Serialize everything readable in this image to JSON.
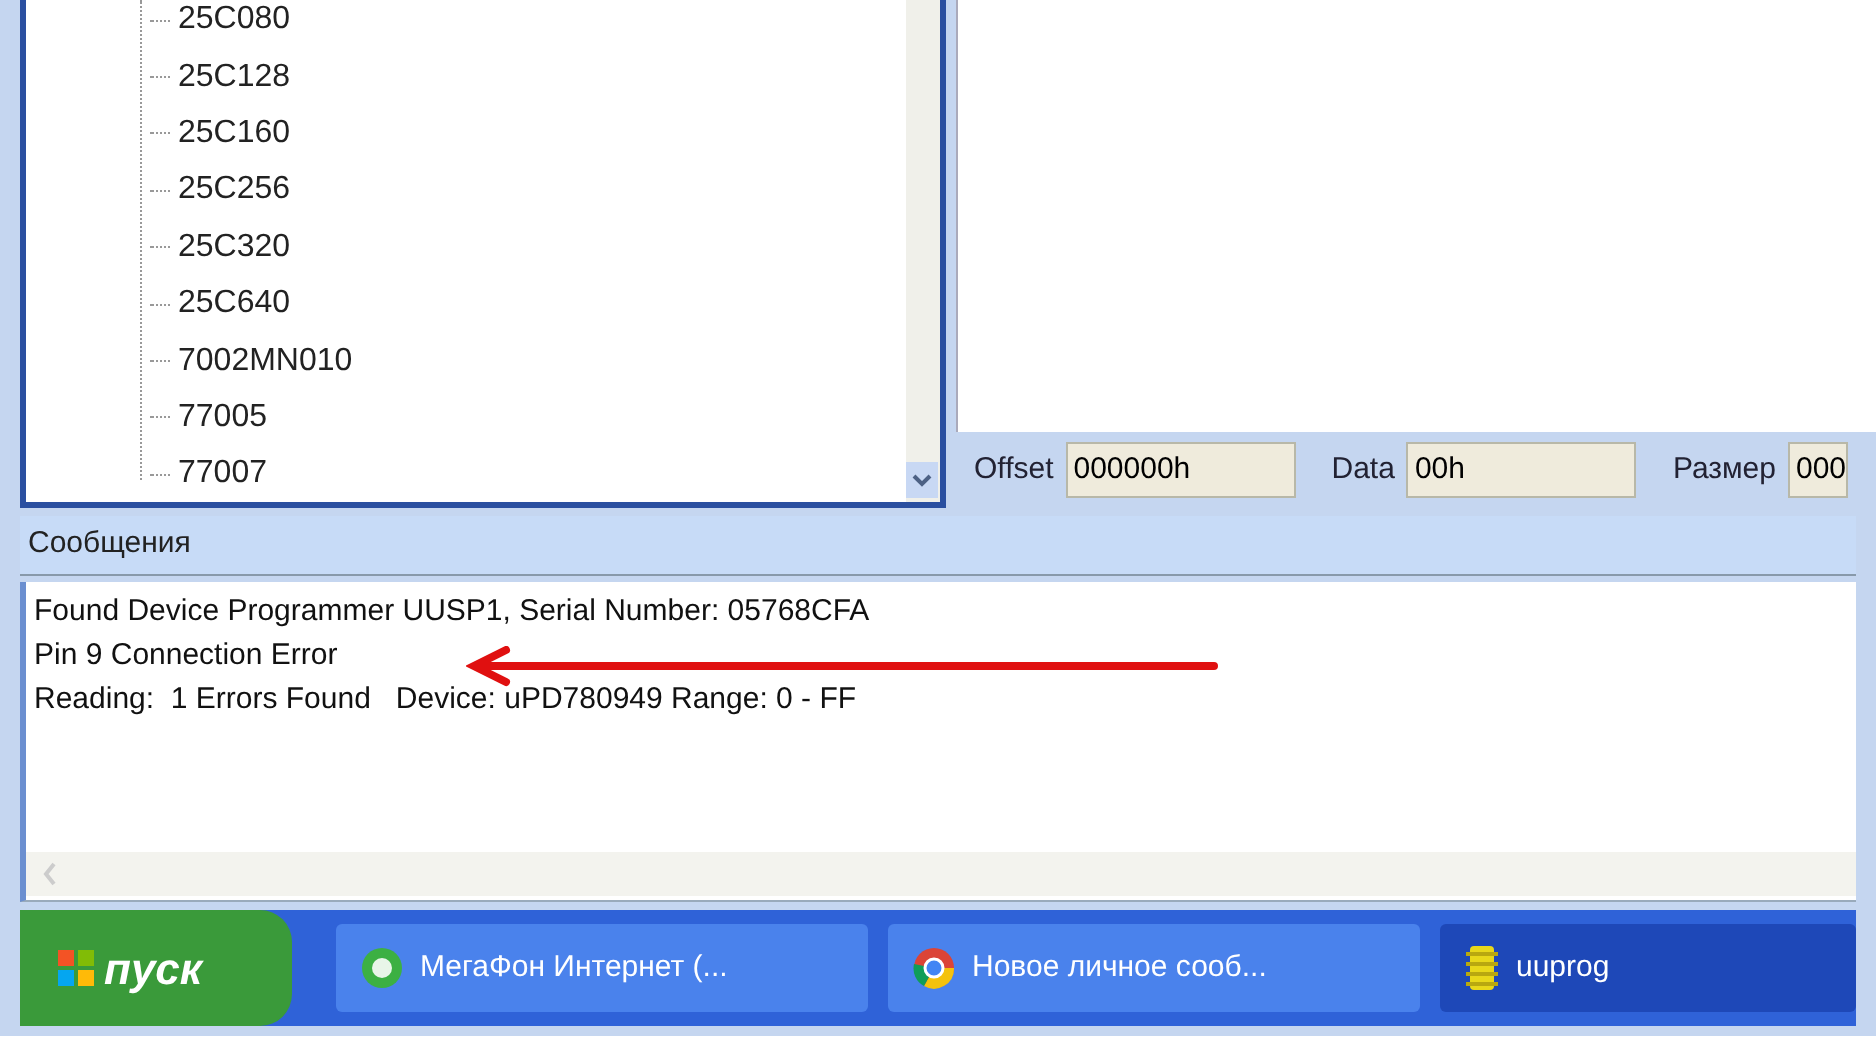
{
  "device_tree": {
    "items": [
      {
        "label": "25C080"
      },
      {
        "label": "25C128"
      },
      {
        "label": "25C160"
      },
      {
        "label": "25C256"
      },
      {
        "label": "25C320"
      },
      {
        "label": "25C640"
      },
      {
        "label": "7002MN010"
      },
      {
        "label": "77005"
      },
      {
        "label": "77007"
      }
    ]
  },
  "edit_bar": {
    "fields": [
      {
        "label": "Offset",
        "value": "000000h"
      },
      {
        "label": "Data",
        "value": "00h"
      },
      {
        "label": "Размер",
        "value": "000"
      }
    ]
  },
  "messages": {
    "title": "Сообщения",
    "lines": [
      "Found Device Programmer UUSP1, Serial Number: 05768CFA",
      "Pin 9 Connection Error",
      "Reading:  1 Errors Found   Device: uPD780949 Range: 0 - FF"
    ]
  },
  "taskbar": {
    "start": "пуск",
    "tasks": [
      {
        "label": "МегаФон Интернет (...",
        "kind": "modem",
        "selected": false
      },
      {
        "label": "Новое личное сооб...",
        "kind": "browser",
        "selected": false
      },
      {
        "label": "uuprog",
        "kind": "chip",
        "selected": true
      }
    ]
  }
}
